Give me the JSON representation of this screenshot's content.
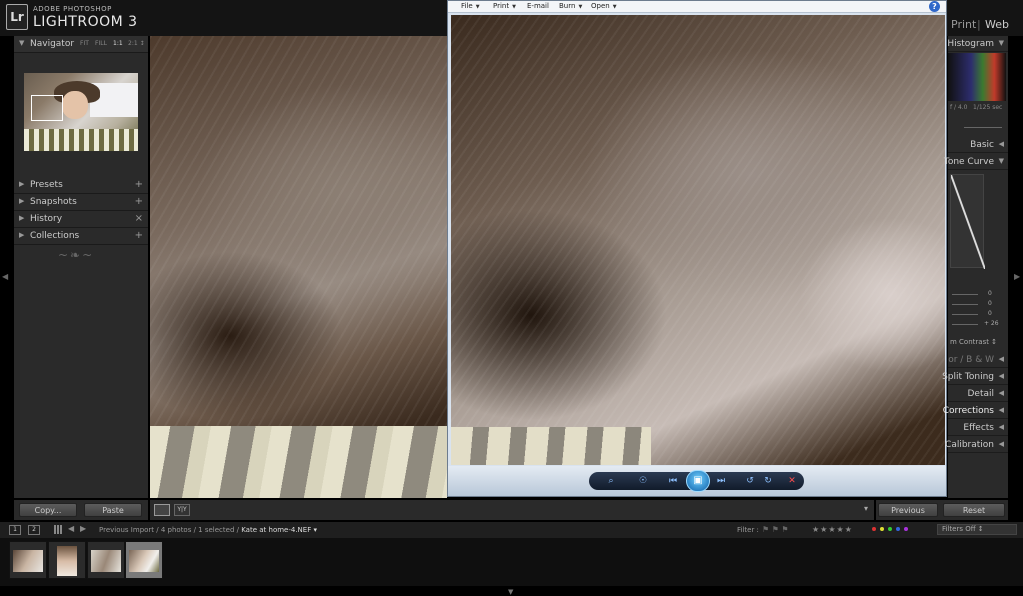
{
  "app": {
    "brand_small": "ADOBE PHOTOSHOP",
    "brand_big": "LIGHTROOM 3",
    "logo": "Lr"
  },
  "modules": {
    "print": "Print",
    "sep": "|",
    "web": "Web"
  },
  "left_panel": {
    "navigator": {
      "label": "Navigator",
      "zoom": [
        "FIT",
        "FILL",
        "1:1",
        "2:1 ↕"
      ]
    },
    "sections": [
      {
        "label": "Presets",
        "action": "+"
      },
      {
        "label": "Snapshots",
        "action": "+"
      },
      {
        "label": "History",
        "action": "×"
      },
      {
        "label": "Collections",
        "action": "+"
      }
    ],
    "ornament": "~❧~"
  },
  "viewer": {
    "menu": [
      {
        "label": "File"
      },
      {
        "label": "Print"
      },
      {
        "label": "E-mail"
      },
      {
        "label": "Burn"
      },
      {
        "label": "Open"
      }
    ],
    "help": "?",
    "toolbar_icons": {
      "zoom": "⌕",
      "fit": "☉",
      "prev": "⏮",
      "slideshow": "▣",
      "next": "⏭",
      "rotate_ccw": "↺",
      "rotate_cw": "↻",
      "delete": "✕"
    }
  },
  "right_panel": {
    "histogram": "Histogram",
    "hist_meta_left": "f / 4.0",
    "hist_meta_right": "1/125 sec",
    "basic": "Basic",
    "tone_curve": "Tone Curve",
    "curve_values": [
      "0",
      "0",
      "0",
      "+ 26"
    ],
    "contrast": "m Contrast ↕",
    "bw": "or  /  B & W",
    "split_toning": "Split Toning",
    "detail": "Detail",
    "corrections": "Corrections",
    "effects": "Effects",
    "calibration": "Calibration"
  },
  "toolbar": {
    "copy": "Copy...",
    "paste": "Paste",
    "previous": "Previous",
    "reset": "Reset",
    "compare_icon": "Y|Y",
    "dropdown": "▾"
  },
  "filmstrip_bar": {
    "num1": "1",
    "num2": "2",
    "prev": "◀",
    "next": "▶",
    "path": "Previous Import / 4 photos / 1 selected / ",
    "filename": "Kate at home-4.NEF ▾",
    "filter_label": "Filter :",
    "flags": "⚑ ⚑ ⚑",
    "stars": "★★★★★",
    "filters_off": "Filters Off ↕"
  },
  "colors": {
    "label_colors": [
      "#d33",
      "#dd3",
      "#3c3",
      "#36d",
      "#a3d"
    ]
  }
}
